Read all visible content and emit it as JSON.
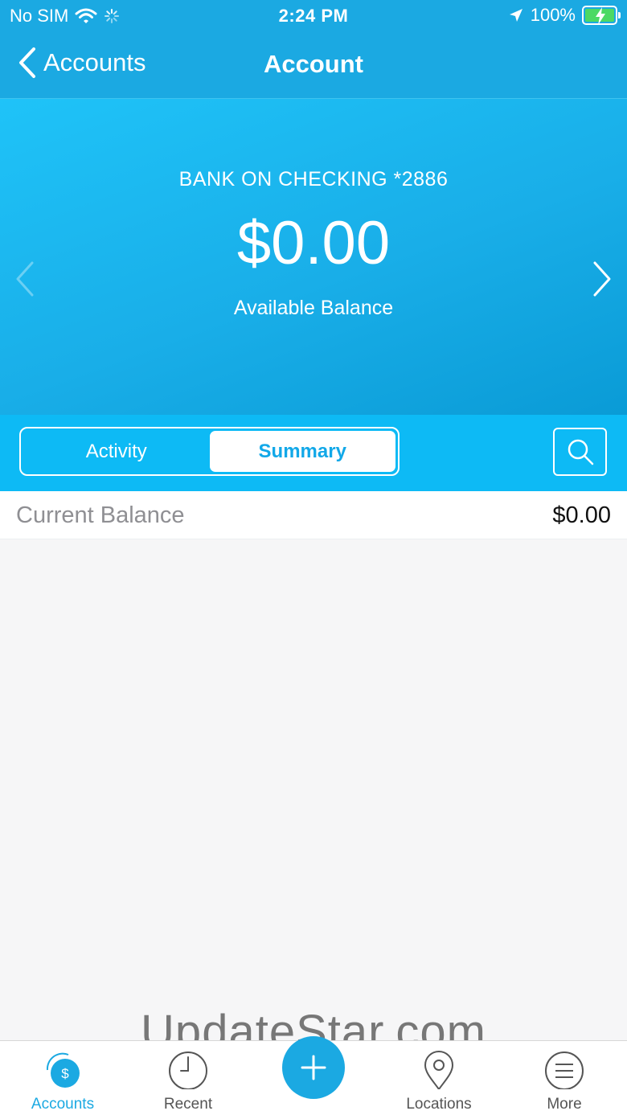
{
  "status_bar": {
    "carrier": "No SIM",
    "time": "2:24 PM",
    "battery": "100%"
  },
  "nav": {
    "back_label": "Accounts",
    "title": "Account"
  },
  "account": {
    "name": "BANK ON CHECKING *2886",
    "available_amount": "$0.00",
    "available_label": "Available Balance"
  },
  "tabs": {
    "activity": "Activity",
    "summary": "Summary",
    "selected": "Summary"
  },
  "summary": {
    "current_balance_label": "Current Balance",
    "current_balance_value": "$0.00"
  },
  "watermark": "UpdateStar.com",
  "tabbar": {
    "items": [
      {
        "label": "Accounts",
        "icon": "accounts-dollar-icon"
      },
      {
        "label": "Recent",
        "icon": "clock-icon"
      },
      {
        "label": "",
        "icon": "plus-icon"
      },
      {
        "label": "Locations",
        "icon": "map-pin-icon"
      },
      {
        "label": "More",
        "icon": "menu-icon"
      }
    ]
  },
  "colors": {
    "accent": "#1ba9e2",
    "segment_bar": "#0dbaf5",
    "battery_fill": "#4cd964"
  }
}
